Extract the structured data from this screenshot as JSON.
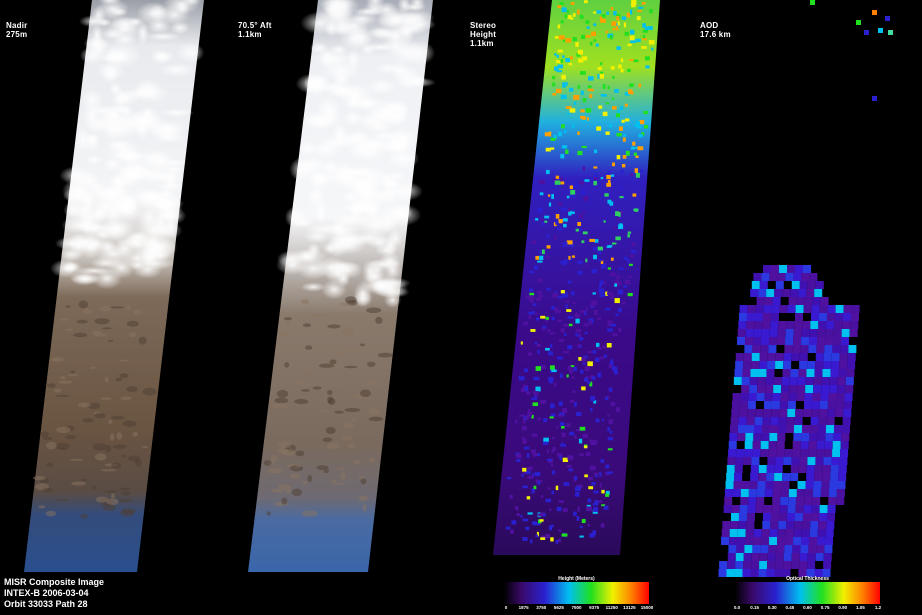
{
  "panels": [
    {
      "title": "Nadir",
      "resolution": "275m"
    },
    {
      "title": "70.5° Aft",
      "resolution": "1.1km"
    },
    {
      "title": "Stereo\nHeight",
      "resolution": "1.1km"
    },
    {
      "title": "AOD",
      "resolution": "17.6 km"
    }
  ],
  "caption": {
    "line1": "MISR Composite Image",
    "line2": "INTEX-B  2006-03-04",
    "line3": "Orbit 33033 Path  28"
  },
  "height_colorbar": {
    "title": "Height (Meters)",
    "ticks": [
      "0",
      "1875",
      "3750",
      "5625",
      "7500",
      "9375",
      "11250",
      "13125",
      "15000"
    ]
  },
  "aod_colorbar": {
    "title": "Optical Thickness",
    "ticks": [
      "0.0",
      "0.15",
      "0.30",
      "0.45",
      "0.60",
      "0.75",
      "0.90",
      "1.05",
      "1.2"
    ]
  },
  "colors": {
    "background": "#000000",
    "cloud": "#f4f5f7",
    "land": "#6f5a48",
    "ocean": "#2a4f8e",
    "stereo_low": "#3a0a8a",
    "aod_low": "#4a10a0"
  }
}
